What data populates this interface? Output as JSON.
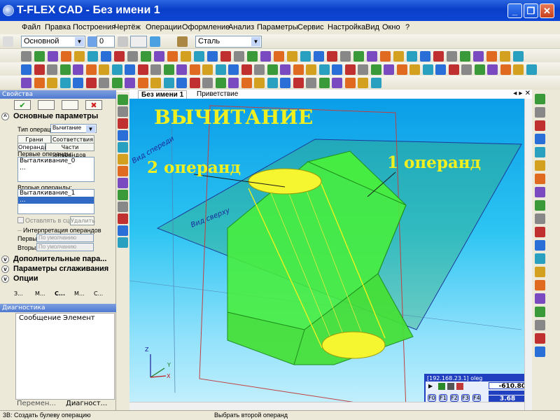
{
  "window": {
    "title": "T-FLEX CAD - Без имени 1"
  },
  "menu": [
    "Файл",
    "Правка",
    "Построения",
    "Чертёж",
    "Операции",
    "Оформление",
    "Анализ",
    "Параметры",
    "Сервис",
    "Настройка",
    "Вид",
    "Окно",
    "?"
  ],
  "layer_bar": {
    "style_value": "Основной",
    "width_value": "0",
    "material_value": "Сталь"
  },
  "doc_tabs": [
    {
      "label": "Без имени 1"
    },
    {
      "label": "Приветствие"
    }
  ],
  "properties": {
    "header": "Свойства",
    "main_section": "Основные параметры",
    "operation_type_label": "Тип операции:",
    "operation_type_value": "Вычитание",
    "tabs": [
      "Грани",
      "Соответствия",
      "Операнды",
      "Части операндов"
    ],
    "first_operands_label": "Первые операнды:",
    "first_operands": [
      "Выталкивание_0",
      "..."
    ],
    "second_operands_label": "Вторые операнды:",
    "second_operands": [
      "Выталкивание_1",
      "..."
    ],
    "keep_in_scene": "Оставлять в сцене",
    "delete_button": "Удалить",
    "interpretation_label": "Интерпретация операндов",
    "first_label": "Первых:",
    "second_label": "Вторых:",
    "default_value": "По умолчанию",
    "sections": [
      "Дополнительные пара...",
      "Параметры сглаживания",
      "Опции"
    ],
    "bottom_tabs": [
      "З...",
      "М...",
      "С...",
      "М...",
      "С..."
    ]
  },
  "diagnostics": {
    "header": "Диагностика",
    "columns": [
      "Сообщение",
      "Элемент"
    ]
  },
  "panel_bottom_tabs": [
    "Перемен...",
    "Диагност..."
  ],
  "viewport": {
    "title_annotation": "ВЫЧИТАНИЕ",
    "operand2_label": "2 операнд",
    "operand1_label": "1 операнд",
    "plane_labels": [
      "Вид сверху",
      "Вид спереди"
    ],
    "axis_labels": [
      "X",
      "Y",
      "Z"
    ]
  },
  "mini_panel": {
    "host": "[192.168.23.1] oleg",
    "value_main": "-610.80",
    "value_sub": "3.68",
    "buttons": [
      "F0",
      "F1",
      "F2",
      "F3",
      "F4"
    ]
  },
  "status": {
    "left": "3В: Создать булеву операцию",
    "center": "Выбрать второй операнд"
  },
  "colors": {
    "titlebar": "#0a3fc8",
    "viewport_top": "#0a9de8",
    "viewport_bottom": "#c7f0fd",
    "shape_green": "#3ee83e",
    "annotation_yellow": "#f0f020"
  }
}
